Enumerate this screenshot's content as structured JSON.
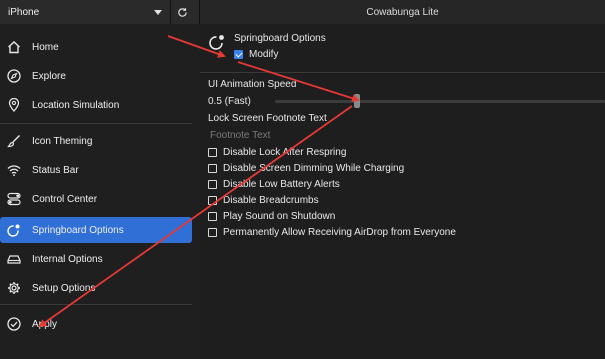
{
  "device": {
    "name": "iPhone"
  },
  "app": {
    "title": "Cowabunga Lite"
  },
  "sidebar": {
    "items": [
      {
        "label": "Home",
        "icon": "house-icon"
      },
      {
        "label": "Explore",
        "icon": "compass-icon"
      },
      {
        "label": "Location Simulation",
        "icon": "location-pin-icon"
      },
      {
        "label": "Icon Theming",
        "icon": "brush-icon"
      },
      {
        "label": "Status Bar",
        "icon": "wifi-icon"
      },
      {
        "label": "Control Center",
        "icon": "toggles-icon"
      },
      {
        "label": "Springboard Options",
        "icon": "springboard-icon"
      },
      {
        "label": "Internal Options",
        "icon": "drive-icon"
      },
      {
        "label": "Setup Options",
        "icon": "gear-icon"
      },
      {
        "label": "Apply",
        "icon": "checkmark-circle-icon"
      }
    ],
    "active_index": 6
  },
  "main": {
    "section_title": "Springboard Options",
    "modify_label": "Modify",
    "modify_checked": true,
    "animation_speed": {
      "label": "UI Animation Speed",
      "value_text": "0.5 (Fast)",
      "value": 0.5
    },
    "footnote": {
      "label": "Lock Screen Footnote Text",
      "placeholder": "Footnote Text"
    },
    "options": [
      {
        "label": "Disable Lock After Respring",
        "checked": false
      },
      {
        "label": "Disable Screen Dimming While Charging",
        "checked": false
      },
      {
        "label": "Disable Low Battery Alerts",
        "checked": false
      },
      {
        "label": "Disable Breadcrumbs",
        "checked": false
      },
      {
        "label": "Play Sound on Shutdown",
        "checked": false
      },
      {
        "label": "Permanently Allow Receiving AirDrop from Everyone",
        "checked": false
      }
    ]
  },
  "colors": {
    "accent": "#2f6fd6",
    "annotation_arrow": "#e53935"
  }
}
